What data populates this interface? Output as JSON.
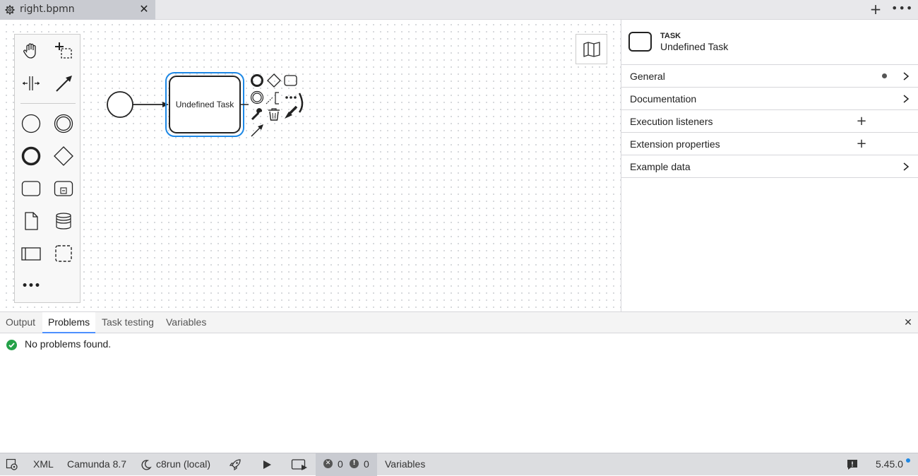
{
  "tab": {
    "label": "right.bpmn",
    "close": "✕",
    "icon": "gear-icon"
  },
  "tabbar": {
    "add": "+",
    "more": "•••"
  },
  "canvas": {
    "task_label": "Undefined Task",
    "palette_tools": [
      "hand-tool-icon",
      "lasso-tool-icon",
      "space-tool-icon",
      "connect-tool-icon",
      "start-event-icon",
      "intermediate-event-icon",
      "end-event-icon",
      "gateway-icon",
      "task-icon",
      "subprocess-icon",
      "data-object-icon",
      "data-store-icon",
      "pool-icon",
      "group-icon",
      "more-tools-icon"
    ],
    "palette_more": "•••",
    "context_pad_more": "•••",
    "minimap": "map-icon"
  },
  "properties": {
    "element_type": "TASK",
    "element_name": "Undefined Task",
    "groups": [
      {
        "label": "General",
        "action": "chevron"
      },
      {
        "label": "Documentation",
        "action": "chevron"
      },
      {
        "label": "Execution listeners",
        "action": "plus"
      },
      {
        "label": "Extension properties",
        "action": "plus"
      },
      {
        "label": "Example data",
        "action": "chevron"
      }
    ],
    "plus": "+"
  },
  "bottom_panel": {
    "tabs": [
      "Output",
      "Problems",
      "Task testing",
      "Variables"
    ],
    "active_tab": "Problems",
    "message": "No problems found.",
    "close": "✕"
  },
  "status_bar": {
    "xml": "XML",
    "platform": "Camunda 8.7",
    "connection": "c8run (local)",
    "errors": "0",
    "warnings": "0",
    "variables": "Variables",
    "version": "5.45.0"
  },
  "colors": {
    "accent": "#4d90fe",
    "selection": "#1e88e5",
    "success": "#24a148"
  }
}
